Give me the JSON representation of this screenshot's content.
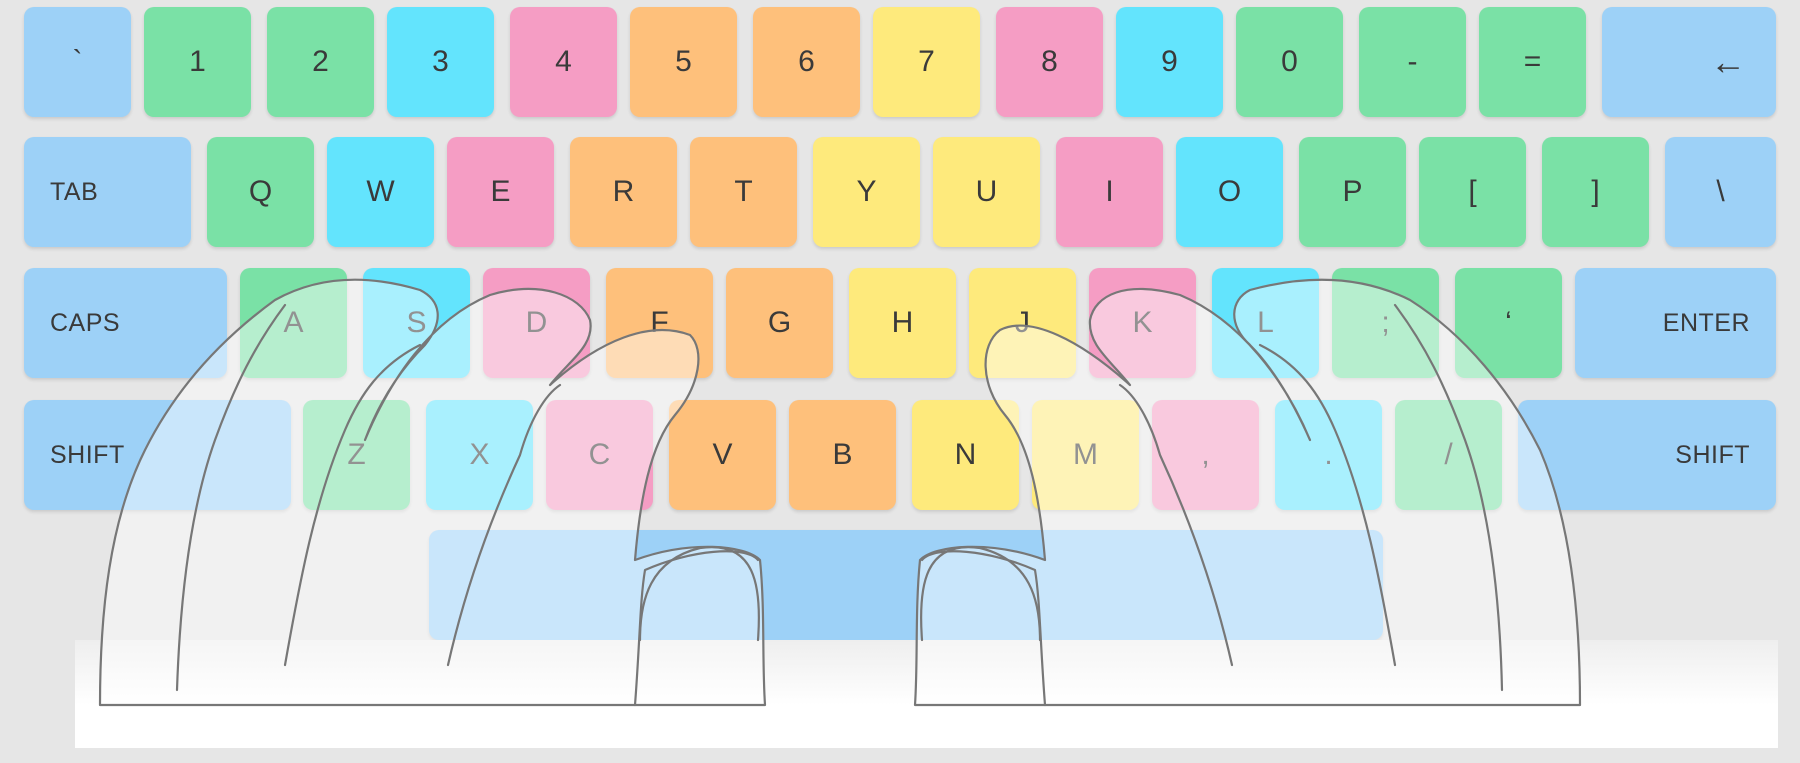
{
  "keyboard": {
    "row1": [
      "`",
      "1",
      "2",
      "3",
      "4",
      "5",
      "6",
      "7",
      "8",
      "9",
      "0",
      "-",
      "=",
      "←"
    ],
    "row2": [
      "TAB",
      "Q",
      "W",
      "E",
      "R",
      "T",
      "Y",
      "U",
      "I",
      "O",
      "P",
      "[",
      "]",
      "\\"
    ],
    "row3": [
      "CAPS",
      "A",
      "S",
      "D",
      "F",
      "G",
      "H",
      "J",
      "K",
      "L",
      ";",
      "‘",
      "ENTER"
    ],
    "row4": [
      "SHIFT",
      "Z",
      "X",
      "C",
      "V",
      "B",
      "N",
      "M",
      ",",
      ".",
      "/",
      "SHIFT"
    ],
    "space_label": ""
  },
  "colors": {
    "modifier": "#9dd1f7",
    "pinky": "#7ae1a6",
    "ring": "#63e4fd",
    "middle": "#f59dc4",
    "left_index": "#fec07b",
    "right_index": "#feea7c"
  }
}
